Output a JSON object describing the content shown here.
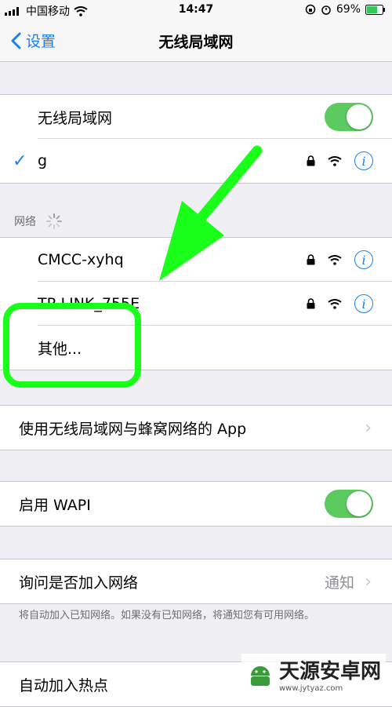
{
  "status_bar": {
    "carrier": "中国移动",
    "time": "14:47",
    "battery": "69%",
    "icons": [
      "signal-icon",
      "wifi-icon",
      "lock-rotation-icon",
      "alarm-icon",
      "battery-icon"
    ]
  },
  "nav": {
    "back_label": "设置",
    "title": "无线局域网"
  },
  "wifi_group": {
    "toggle_label": "无线局域网",
    "toggle_on": true,
    "connected_network": "g"
  },
  "networks_header": "网络",
  "networks": [
    {
      "name": "CMCC-xyhq",
      "locked": true
    },
    {
      "name": "TP-LINK_755E",
      "locked": true
    }
  ],
  "other_label": "其他...",
  "apps_label": "使用无线局域网与蜂窝网络的 App",
  "wapi_label": "启用 WAPI",
  "wapi_on": true,
  "ask_join": {
    "label": "询问是否加入网络",
    "value": "通知"
  },
  "ask_join_footer": "将自动加入已知网络。如果没有已知网络，将通知您有可用网络。",
  "hotspot_label": "自动加入热点",
  "annotation_color": "#19ff19",
  "accent_color": "#1a7ff5",
  "toggle_color": "#5ccb5f",
  "watermark": {
    "title": "天源安卓网",
    "url": "www.jytyaz.com"
  }
}
